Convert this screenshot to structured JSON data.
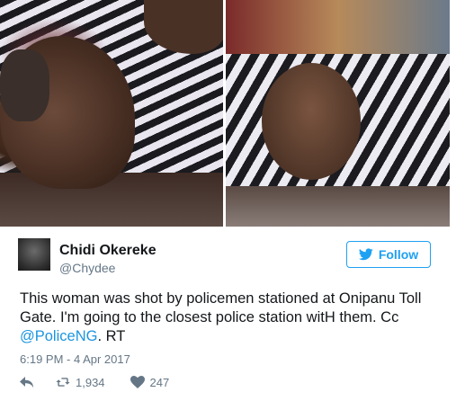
{
  "media": {
    "photos": [
      {
        "name": "photo-1"
      },
      {
        "name": "photo-2"
      }
    ]
  },
  "author": {
    "name": "Chidi Okereke",
    "handle": "@Chydee"
  },
  "follow_button": {
    "label": "Follow",
    "icon": "twitter-bird-icon",
    "color": "#1da1f2"
  },
  "tweet": {
    "text_part1": "This woman was shot by policemen stationed at Onipanu Toll Gate. I'm going to the closest police station witH them. Cc ",
    "mention": "@PoliceNG",
    "text_part2": ". RT",
    "mention_color": "#1b95e0",
    "timestamp": "6:19 PM - 4 Apr 2017"
  },
  "actions": {
    "reply_icon": "reply-icon",
    "retweet_icon": "retweet-icon",
    "retweet_count": "1,934",
    "like_icon": "heart-icon",
    "like_count": "247"
  }
}
